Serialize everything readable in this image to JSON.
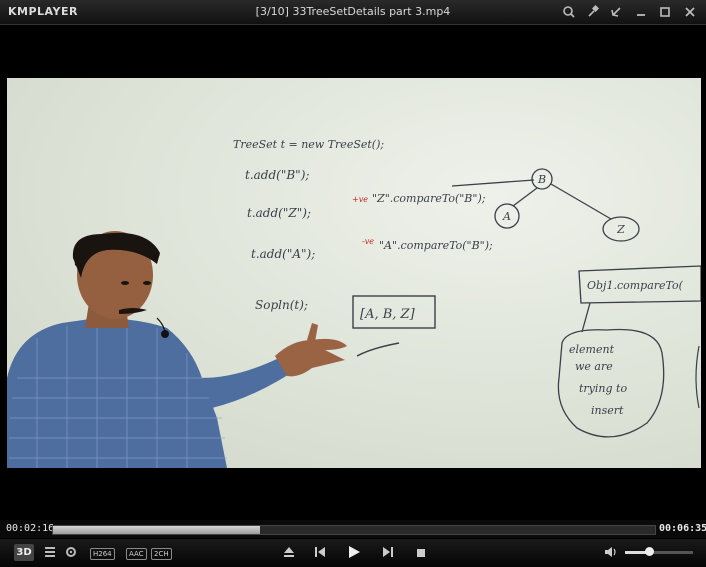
{
  "app": {
    "logo": "KMPLAYER",
    "title": "[3/10] 33TreeSetDetails part 3.mp4"
  },
  "titlebar_icons": [
    "search-icon",
    "pin-icon",
    "shrink-icon",
    "minimize-icon",
    "maximize-icon",
    "close-icon"
  ],
  "playback": {
    "elapsed": "00:02:16",
    "total": "00:06:35",
    "progress": 0.344
  },
  "badges": {
    "codec": "H264",
    "audio": "AAC",
    "channels": "2CH",
    "mode_3d": "3D"
  },
  "volume": {
    "level": 0.36
  },
  "whiteboard": {
    "line1": "TreeSet t = new TreeSet();",
    "line2": "t.add(\"B\");",
    "line3": "t.add(\"Z\");",
    "line3b": "\"Z\".compareTo(\"B\");",
    "line4": "t.add(\"A\");",
    "line4b": "\"A\".compareTo(\"B\");",
    "line5": "Sopln(t);",
    "result": "[A, B, Z]",
    "plus": "+ve",
    "minus": "-ve",
    "tree_root": "B",
    "tree_left": "A",
    "tree_right": "Z",
    "box_text": "Obj1.compareTo(",
    "cloud_line1": "element",
    "cloud_line2": "we are",
    "cloud_line3": "trying to",
    "cloud_line4": "insert"
  },
  "colors": {
    "accent": "#c0c0c0",
    "board": "#e1e6da",
    "ink": "#3a3f4a",
    "red_ink": "#c02020",
    "shirt": "#4e6ea0"
  }
}
